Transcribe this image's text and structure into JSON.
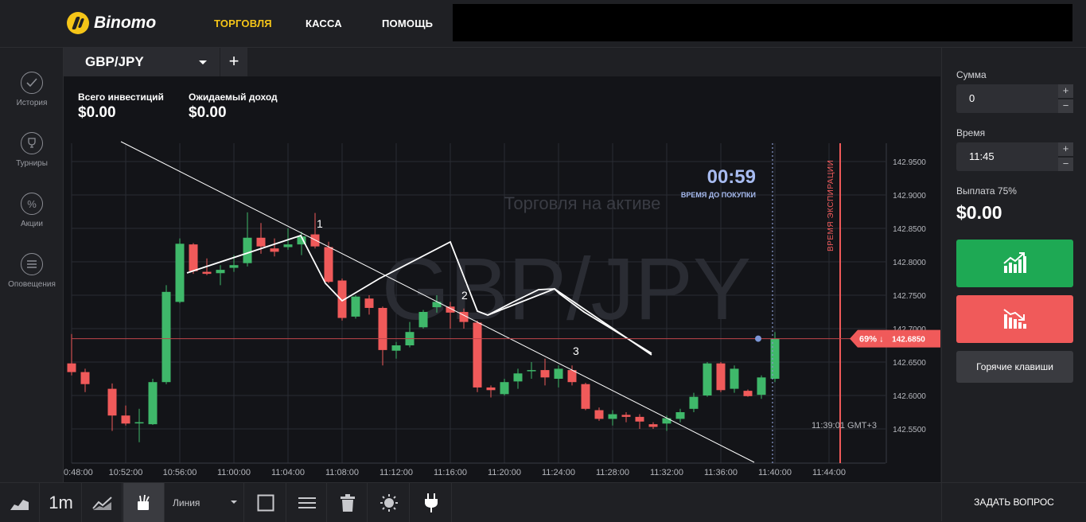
{
  "header": {
    "logo_text": "Binomo",
    "nav": [
      "ТОРГОВЛЯ",
      "КАССА",
      "ПОМОЩЬ"
    ]
  },
  "sidebar": {
    "items": [
      {
        "label": "История",
        "icon": "check-icon"
      },
      {
        "label": "Турниры",
        "icon": "trophy-icon"
      },
      {
        "label": "Акции",
        "icon": "percent-icon"
      },
      {
        "label": "Оповещения",
        "icon": "list-icon"
      }
    ]
  },
  "asset_tab": {
    "name": "GBP/JPY",
    "add": "+"
  },
  "investments": {
    "total_label": "Всего инвестиций",
    "total_value": "$0.00",
    "expected_label": "Ожидаемый доход",
    "expected_value": "$0.00"
  },
  "chart": {
    "watermark_top": "Торговля на активе",
    "watermark_asset": "GBP/JPY",
    "timer_value": "00:59",
    "timer_label": "ВРЕМЯ ДО ПОКУПКИ",
    "expiry_label": "ВРЕМЯ ЭКСПИРАЦИИ",
    "server_time": "11:39:01 GMT+3",
    "current_price_badge": "69% ↓",
    "current_price": "142.6850",
    "annotations": [
      "1",
      "2",
      "3"
    ],
    "colors": {
      "up": "#3fb86a",
      "down": "#f05a5a",
      "expiry": "#f05a5a"
    }
  },
  "chart_data": {
    "type": "candlestick",
    "title": "",
    "xlabel": "",
    "ylabel": "",
    "x_ticks": [
      "0:48:00",
      "10:52:00",
      "10:56:00",
      "11:00:00",
      "11:04:00",
      "11:08:00",
      "11:12:00",
      "11:16:00",
      "11:20:00",
      "11:24:00",
      "11:28:00",
      "11:32:00",
      "11:36:00",
      "11:40:00",
      "11:44:00"
    ],
    "y_ticks": [
      "142.9500",
      "142.9000",
      "142.8500",
      "142.8000",
      "142.7500",
      "142.7000",
      "142.6500",
      "142.6000",
      "142.5500"
    ],
    "ylim": [
      142.505,
      142.98
    ],
    "candles": [
      {
        "t": "10:48",
        "o": 142.648,
        "h": 142.692,
        "l": 142.63,
        "c": 142.635
      },
      {
        "t": "10:49",
        "o": 142.635,
        "h": 142.64,
        "l": 142.605,
        "c": 142.617
      },
      {
        "t": "10:51",
        "o": 142.61,
        "h": 142.618,
        "l": 142.547,
        "c": 142.57
      },
      {
        "t": "10:52",
        "o": 142.57,
        "h": 142.585,
        "l": 142.555,
        "c": 142.558
      },
      {
        "t": "10:53",
        "o": 142.559,
        "h": 142.58,
        "l": 142.53,
        "c": 142.56
      },
      {
        "t": "10:54",
        "o": 142.557,
        "h": 142.625,
        "l": 142.556,
        "c": 142.62
      },
      {
        "t": "10:55",
        "o": 142.62,
        "h": 142.765,
        "l": 142.617,
        "c": 142.755
      },
      {
        "t": "10:56",
        "o": 142.74,
        "h": 142.835,
        "l": 142.738,
        "c": 142.827
      },
      {
        "t": "10:57",
        "o": 142.826,
        "h": 142.828,
        "l": 142.782,
        "c": 142.786
      },
      {
        "t": "10:58",
        "o": 142.785,
        "h": 142.805,
        "l": 142.78,
        "c": 142.782
      },
      {
        "t": "10:59",
        "o": 142.783,
        "h": 142.795,
        "l": 142.765,
        "c": 142.788
      },
      {
        "t": "11:00",
        "o": 142.791,
        "h": 142.81,
        "l": 142.785,
        "c": 142.795
      },
      {
        "t": "11:01",
        "o": 142.798,
        "h": 142.874,
        "l": 142.793,
        "c": 142.836
      },
      {
        "t": "11:02",
        "o": 142.836,
        "h": 142.858,
        "l": 142.812,
        "c": 142.823
      },
      {
        "t": "11:03",
        "o": 142.82,
        "h": 142.835,
        "l": 142.808,
        "c": 142.815
      },
      {
        "t": "11:04",
        "o": 142.822,
        "h": 142.85,
        "l": 142.818,
        "c": 142.826
      },
      {
        "t": "11:05",
        "o": 142.826,
        "h": 142.845,
        "l": 142.81,
        "c": 142.838
      },
      {
        "t": "11:06",
        "o": 142.841,
        "h": 142.873,
        "l": 142.82,
        "c": 142.823
      },
      {
        "t": "11:07",
        "o": 142.822,
        "h": 142.83,
        "l": 142.768,
        "c": 142.77
      },
      {
        "t": "11:08",
        "o": 142.772,
        "h": 142.775,
        "l": 142.712,
        "c": 142.716
      },
      {
        "t": "11:09",
        "o": 142.718,
        "h": 142.75,
        "l": 142.715,
        "c": 142.748
      },
      {
        "t": "11:10",
        "o": 142.745,
        "h": 142.75,
        "l": 142.721,
        "c": 142.731
      },
      {
        "t": "11:11",
        "o": 142.731,
        "h": 142.733,
        "l": 142.645,
        "c": 142.668
      },
      {
        "t": "11:12",
        "o": 142.667,
        "h": 142.68,
        "l": 142.655,
        "c": 142.675
      },
      {
        "t": "11:13",
        "o": 142.675,
        "h": 142.71,
        "l": 142.672,
        "c": 142.695
      },
      {
        "t": "11:14",
        "o": 142.702,
        "h": 142.728,
        "l": 142.7,
        "c": 142.725
      },
      {
        "t": "11:15",
        "o": 142.732,
        "h": 142.75,
        "l": 142.724,
        "c": 142.74
      },
      {
        "t": "11:16",
        "o": 142.733,
        "h": 142.74,
        "l": 142.7,
        "c": 142.724
      },
      {
        "t": "11:17",
        "o": 142.725,
        "h": 142.73,
        "l": 142.7,
        "c": 142.71
      },
      {
        "t": "11:18",
        "o": 142.709,
        "h": 142.712,
        "l": 142.605,
        "c": 142.612
      },
      {
        "t": "11:19",
        "o": 142.612,
        "h": 142.615,
        "l": 142.597,
        "c": 142.608
      },
      {
        "t": "11:20",
        "o": 142.602,
        "h": 142.625,
        "l": 142.6,
        "c": 142.62
      },
      {
        "t": "11:21",
        "o": 142.621,
        "h": 142.64,
        "l": 142.61,
        "c": 142.633
      },
      {
        "t": "11:22",
        "o": 142.637,
        "h": 142.65,
        "l": 142.625,
        "c": 142.638
      },
      {
        "t": "11:23",
        "o": 142.638,
        "h": 142.655,
        "l": 142.615,
        "c": 142.627
      },
      {
        "t": "11:24",
        "o": 142.625,
        "h": 142.645,
        "l": 142.612,
        "c": 142.64
      },
      {
        "t": "11:25",
        "o": 142.638,
        "h": 142.645,
        "l": 142.615,
        "c": 142.62
      },
      {
        "t": "11:26",
        "o": 142.617,
        "h": 142.619,
        "l": 142.578,
        "c": 142.58
      },
      {
        "t": "11:27",
        "o": 142.578,
        "h": 142.582,
        "l": 142.562,
        "c": 142.565
      },
      {
        "t": "11:28",
        "o": 142.565,
        "h": 142.578,
        "l": 142.555,
        "c": 142.572
      },
      {
        "t": "11:29",
        "o": 142.571,
        "h": 142.575,
        "l": 142.56,
        "c": 142.568
      },
      {
        "t": "11:30",
        "o": 142.568,
        "h": 142.572,
        "l": 142.55,
        "c": 142.561
      },
      {
        "t": "11:31",
        "o": 142.557,
        "h": 142.56,
        "l": 142.55,
        "c": 142.553
      },
      {
        "t": "11:32",
        "o": 142.558,
        "h": 142.57,
        "l": 142.547,
        "c": 142.566
      },
      {
        "t": "11:33",
        "o": 142.565,
        "h": 142.58,
        "l": 142.56,
        "c": 142.575
      },
      {
        "t": "11:34",
        "o": 142.58,
        "h": 142.604,
        "l": 142.575,
        "c": 142.598
      },
      {
        "t": "11:35",
        "o": 142.6,
        "h": 142.65,
        "l": 142.598,
        "c": 142.648
      },
      {
        "t": "11:36",
        "o": 142.648,
        "h": 142.65,
        "l": 142.605,
        "c": 142.608
      },
      {
        "t": "11:37",
        "o": 142.61,
        "h": 142.645,
        "l": 142.604,
        "c": 142.64
      },
      {
        "t": "11:38",
        "o": 142.607,
        "h": 142.609,
        "l": 142.598,
        "c": 142.599
      },
      {
        "t": "11:39",
        "o": 142.601,
        "h": 142.63,
        "l": 142.595,
        "c": 142.627
      },
      {
        "t": "11:40",
        "o": 142.625,
        "h": 142.695,
        "l": 142.62,
        "c": 142.685
      }
    ],
    "current_price": 142.685
  },
  "trade_panel": {
    "amount_label": "Сумма",
    "amount_value": "0",
    "time_label": "Время",
    "time_value": "11:45",
    "payout_label": "Выплата 75%",
    "payout_value": "$0.00",
    "up_color": "#1ea954",
    "down_color": "#f05a5a",
    "hotkeys": "Горячие клавиши"
  },
  "toolbar": {
    "timeframe": "1m",
    "draw_tool": "Линия",
    "ask": "ЗАДАТЬ ВОПРОС"
  }
}
